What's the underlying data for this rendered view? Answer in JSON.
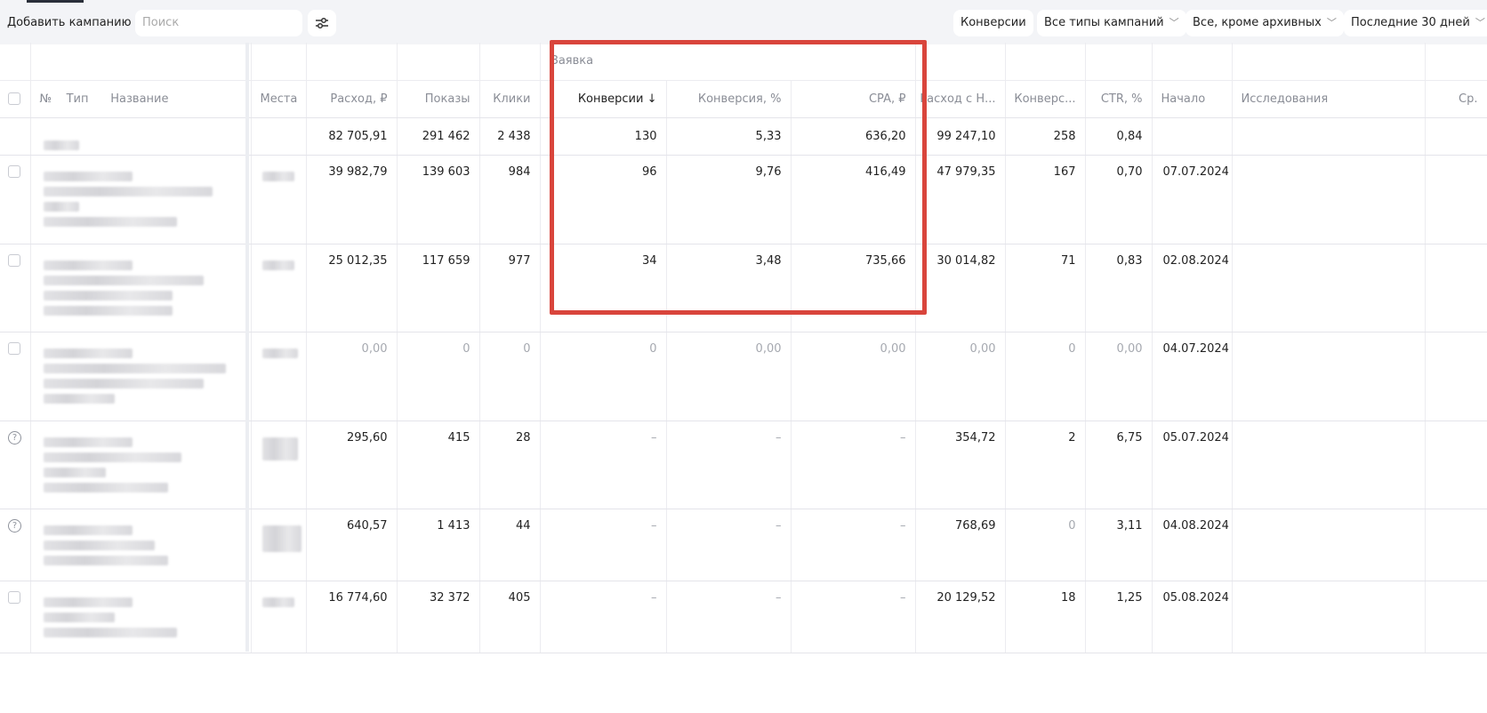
{
  "toolbar": {
    "add_campaign": "Добавить кампанию",
    "search_placeholder": "Поиск",
    "conversions": "Конверсии",
    "campaign_types": "Все типы кампаний",
    "status_filter": "Все, кроме архивных",
    "period": "Последние 30 дней"
  },
  "group": {
    "label": "Заявка"
  },
  "columns": {
    "num": "№",
    "type": "Тип",
    "name": "Название",
    "places": "Места",
    "spend": "Расход, ₽",
    "impressions": "Показы",
    "clicks": "Клики",
    "conversions": "Конверсии",
    "conversions_sort": "↓",
    "conv_rate": "Конверсия, %",
    "cpa": "CPA, ₽",
    "spend_vat": "Расход с Н...",
    "conv2": "Конверс...",
    "ctr": "CTR, %",
    "start": "Начало",
    "research": "Исследования",
    "avg": "Ср."
  },
  "totals": {
    "spend": "82 705,91",
    "impressions": "291 462",
    "clicks": "2 438",
    "conversions": "130",
    "conv_rate": "5,33",
    "cpa": "636,20",
    "spend_vat": "99 247,10",
    "conv2": "258",
    "ctr": "0,84"
  },
  "rows": [
    {
      "spend": "39 982,79",
      "impressions": "139 603",
      "clicks": "984",
      "conversions": "96",
      "conv_rate": "9,76",
      "cpa": "416,49",
      "spend_vat": "47 979,35",
      "conv2": "167",
      "ctr": "0,70",
      "start": "07.07.2024"
    },
    {
      "spend": "25 012,35",
      "impressions": "117 659",
      "clicks": "977",
      "conversions": "34",
      "conv_rate": "3,48",
      "cpa": "735,66",
      "spend_vat": "30 014,82",
      "conv2": "71",
      "ctr": "0,83",
      "start": "02.08.2024"
    },
    {
      "spend": "0,00",
      "impressions": "0",
      "clicks": "0",
      "conversions": "0",
      "conv_rate": "0,00",
      "cpa": "0,00",
      "spend_vat": "0,00",
      "conv2": "0",
      "ctr": "0,00",
      "start": "04.07.2024"
    },
    {
      "spend": "295,60",
      "impressions": "415",
      "clicks": "28",
      "conversions": "–",
      "conv_rate": "–",
      "cpa": "–",
      "spend_vat": "354,72",
      "conv2": "2",
      "ctr": "6,75",
      "start": "05.07.2024"
    },
    {
      "spend": "640,57",
      "impressions": "1 413",
      "clicks": "44",
      "conversions": "–",
      "conv_rate": "–",
      "cpa": "–",
      "spend_vat": "768,69",
      "conv2": "0",
      "ctr": "3,11",
      "start": "04.08.2024"
    },
    {
      "spend": "16 774,60",
      "impressions": "32 372",
      "clicks": "405",
      "conversions": "–",
      "conv_rate": "–",
      "cpa": "–",
      "spend_vat": "20 129,52",
      "conv2": "18",
      "ctr": "1,25",
      "start": "05.08.2024"
    }
  ],
  "highlight_color": "#d9453c"
}
